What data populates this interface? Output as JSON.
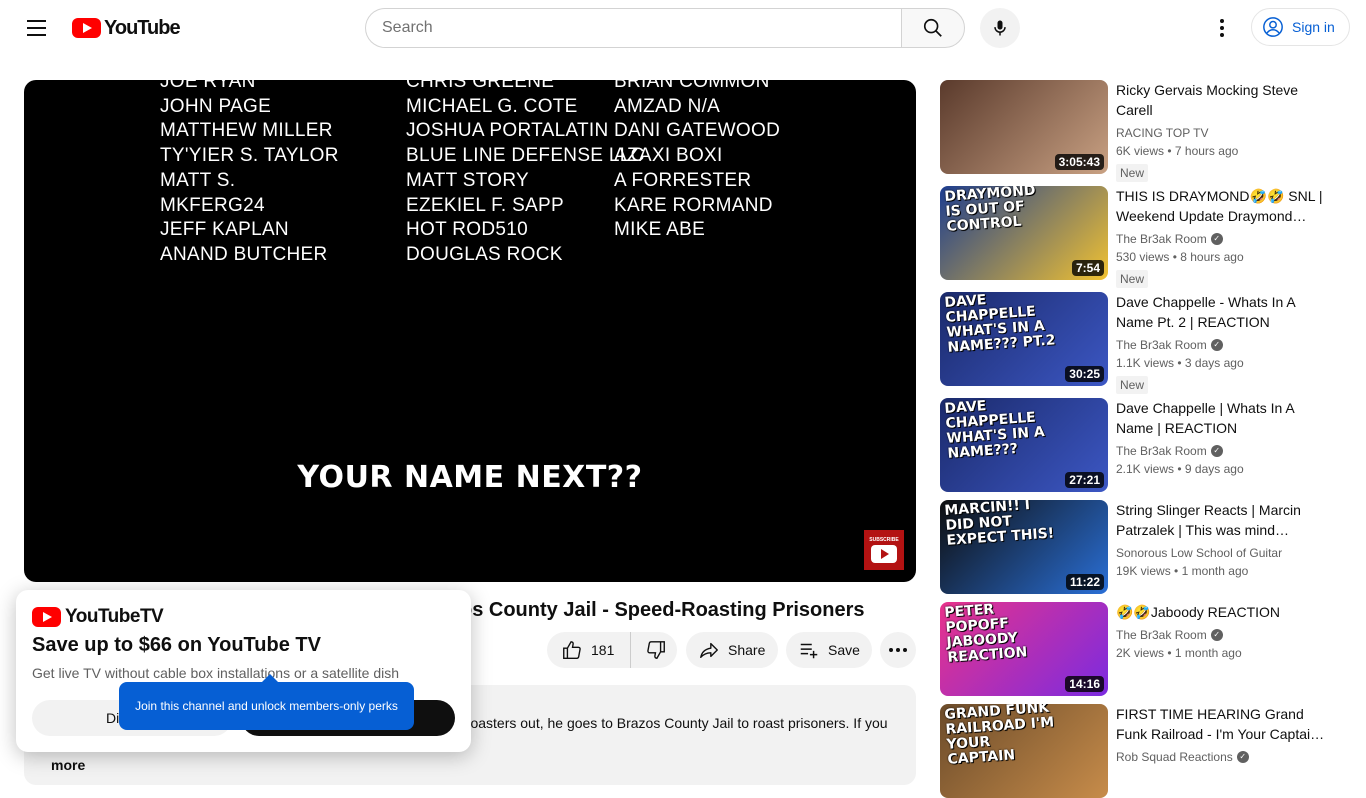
{
  "header": {
    "logo_text": "YouTube",
    "search_placeholder": "Search",
    "signin_label": "Sign in"
  },
  "player": {
    "credits": {
      "col1": [
        "JOE RYAN",
        "JOHN PAGE",
        "MATTHEW MILLER",
        "TY'YIER S. TAYLOR",
        "MATT S.",
        "MKFERG24",
        "JEFF KAPLAN",
        "ANAND BUTCHER"
      ],
      "col2": [
        "CHRIS GREENE",
        "MICHAEL G. COTE",
        "JOSHUA PORTALATIN",
        "BLUE LINE DEFENSE LLC",
        "MATT STORY",
        "EZEKIEL F. SAPP",
        "HOT ROD510",
        "DOUGLAS ROCK"
      ],
      "col3": [
        "BRIAN COMMON",
        "AMZAD N/A",
        "DANI GATEWOOD",
        "AZAXI BOXI",
        "A FORRESTER",
        "KARE RORMAND",
        "MIKE ABE"
      ]
    },
    "overlay_text": "YOUR NAME NEXT??",
    "watermark_text": "SUBSCRIBE"
  },
  "video": {
    "title_visible": "os County Jail - Speed-Roasting Prisoners",
    "like_count": "181",
    "share_label": "Share",
    "save_label": "Save",
    "description_visible": "t roasters out, he goes to Brazos County Jail to roast prisoners. If you",
    "description_more": "more"
  },
  "recommendations": [
    {
      "title": "Ricky Gervais Mocking Steve Carell",
      "channel": "RACING TOP TV",
      "verified": false,
      "views": "6K views",
      "age": "7 hours ago",
      "badge": "New",
      "duration": "3:05:43",
      "thumb_caption": "",
      "thumb_colors": [
        "#5a3a2c",
        "#c9a183"
      ]
    },
    {
      "title": "THIS IS DRAYMOND🤣🤣 SNL | Weekend Update Draymond…",
      "channel": "The Br3ak Room",
      "verified": true,
      "views": "530 views",
      "age": "8 hours ago",
      "badge": "New",
      "duration": "7:54",
      "thumb_caption": "DRAYMOND IS OUT OF CONTROL",
      "thumb_colors": [
        "#1d3d8f",
        "#f1c232"
      ]
    },
    {
      "title": "Dave Chappelle - Whats In A Name Pt. 2 | REACTION",
      "channel": "The Br3ak Room",
      "verified": true,
      "views": "1.1K views",
      "age": "3 days ago",
      "badge": "New",
      "duration": "30:25",
      "thumb_caption": "DAVE CHAPPELLE WHAT'S IN A NAME??? PT.2",
      "thumb_colors": [
        "#1b2a6b",
        "#3c57c4"
      ]
    },
    {
      "title": "Dave Chappelle | Whats In A Name | REACTION",
      "channel": "The Br3ak Room",
      "verified": true,
      "views": "2.1K views",
      "age": "9 days ago",
      "badge": "",
      "duration": "27:21",
      "thumb_caption": "DAVE CHAPPELLE WHAT'S IN A NAME???",
      "thumb_colors": [
        "#1b2a6b",
        "#3c57c4"
      ]
    },
    {
      "title": "String Slinger Reacts | Marcin Patrzalek | This was mind…",
      "channel": "Sonorous Low School of Guitar",
      "verified": false,
      "views": "19K views",
      "age": "1 month ago",
      "badge": "",
      "duration": "11:22",
      "thumb_caption": "MARCIN!! I DID NOT EXPECT THIS!",
      "thumb_colors": [
        "#0e0e0e",
        "#2a6fd6"
      ]
    },
    {
      "title": "🤣🤣Jaboody REACTION",
      "channel": "The Br3ak Room",
      "verified": true,
      "views": "2K views",
      "age": "1 month ago",
      "badge": "",
      "duration": "14:16",
      "thumb_caption": "PETER POPOFF JABOODY REACTION",
      "thumb_colors": [
        "#e8338b",
        "#7b2be0"
      ]
    },
    {
      "title": "FIRST TIME HEARING Grand Funk Railroad - I'm Your Captai…",
      "channel": "Rob Squad Reactions",
      "verified": true,
      "views": "",
      "age": "",
      "badge": "",
      "duration": "",
      "thumb_caption": "GRAND FUNK RAILROAD I'M YOUR CAPTAIN",
      "thumb_colors": [
        "#6b4b2a",
        "#c78c4a"
      ]
    }
  ],
  "promo": {
    "logo_text": "YouTubeTV",
    "headline": "Save up to $66 on YouTube TV",
    "subtext": "Get live TV without cable box installations or a satellite dish",
    "dismiss_label": "Di",
    "tooltip": "Join this channel and unlock members-only perks"
  },
  "colors": {
    "brand_red": "#ff0000",
    "link_blue": "#065fd4",
    "tooltip_blue": "#065fd4"
  }
}
